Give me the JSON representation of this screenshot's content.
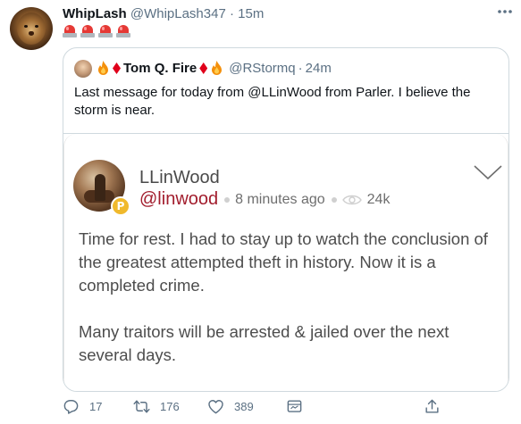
{
  "tweet": {
    "display_name": "WhipLash",
    "handle": "@WhipLash347",
    "separator": "·",
    "time": "15m",
    "emoji_row": [
      "rotating-light",
      "rotating-light",
      "rotating-light",
      "rotating-light"
    ]
  },
  "quoted": {
    "display_name": "Tom Q. Fire",
    "handle": "@RStormq",
    "separator": "·",
    "time": "24m",
    "text": "Last message for today from @LLinWood from Parler. I believe the storm is near."
  },
  "parler_post": {
    "name": "LLinWood",
    "handle": "@linwood",
    "time_ago": "8 minutes ago",
    "views": "24k",
    "badge": "P",
    "paragraph_1": "Time for rest. I had to stay up to watch the conclusion of the greatest attempted theft in history. Now it is a completed crime.",
    "paragraph_2": "Many traitors will be arrested & jailed over the next several days.",
    "brand_color": "#a21d2d"
  },
  "actions": {
    "reply_count": "17",
    "retweet_count": "176",
    "like_count": "389"
  },
  "icons": [
    "more-icon",
    "reply-icon",
    "retweet-icon",
    "like-icon",
    "share-icon",
    "upload-icon",
    "eye-icon",
    "chevron-down-icon"
  ]
}
